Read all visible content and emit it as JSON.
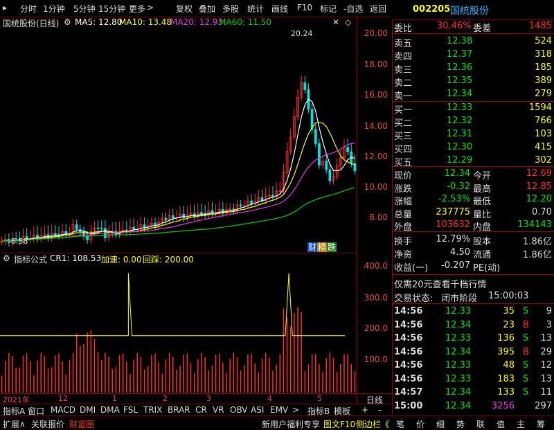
{
  "toolbar": {
    "items": [
      "分时",
      "1分钟",
      "5分钟",
      "15分钟",
      "更多",
      "复权",
      "叠加",
      "多股",
      "统计",
      "画线",
      "F10",
      "标记",
      "-自选",
      "返回"
    ]
  },
  "stock": {
    "code": "002205",
    "name": "国统股份"
  },
  "chart_header": {
    "title": "国统股份(日线)",
    "ma5": "MA5: 12.80",
    "ma10": "MA10: 13.48",
    "ma20": "MA20: 12.93",
    "ma60": "MA60: 11.50",
    "high_label": "20.24",
    "low_label": "6.58",
    "badges": [
      "财",
      "精",
      "跌"
    ]
  },
  "indicator_header": {
    "label": "指标公式",
    "cr1": "CR1: 108.53",
    "speed": "加速: 0.00",
    "pullback": "回踩: 200.00"
  },
  "y_axis": {
    "main_ticks": [
      "20.00",
      "18.00",
      "16.00",
      "14.00",
      "12.00",
      "10.00",
      "8.00"
    ],
    "ind_ticks": [
      "400.0",
      "300.0",
      "200.0",
      "100.0"
    ]
  },
  "date_axis": {
    "labels": [
      "2021年",
      "12",
      "1",
      "2",
      "3",
      "4",
      "5"
    ],
    "right": "日线"
  },
  "indicator_tabs": [
    "指标A",
    "窗口",
    "MACD",
    "DMI",
    "DMA",
    "FSL",
    "TRIX",
    "BRAR",
    "CR",
    "VR",
    "OBV",
    "ASI",
    "EMV",
    "指标B",
    "模板"
  ],
  "bottom_bar": {
    "left": [
      "扩展∧",
      "关联报价",
      "财富圈"
    ],
    "middle": [
      "新用户福利专享",
      "图文F10",
      "侧边栏《"
    ],
    "right_tabs": [
      "笔",
      "价",
      "细",
      "势",
      "联",
      "值",
      "主",
      "筹"
    ]
  },
  "quote": {
    "wei_bi_label": "委比",
    "wei_bi": "30.46%",
    "wei_cha_label": "委差",
    "wei_cha": "1485",
    "asks": [
      {
        "label": "卖五",
        "price": "12.38",
        "vol": "524"
      },
      {
        "label": "卖四",
        "price": "12.37",
        "vol": "318"
      },
      {
        "label": "卖三",
        "price": "12.36",
        "vol": "185"
      },
      {
        "label": "卖二",
        "price": "12.35",
        "vol": "389"
      },
      {
        "label": "卖一",
        "price": "12.34",
        "vol": "279"
      }
    ],
    "bids": [
      {
        "label": "买一",
        "price": "12.33",
        "vol": "1594"
      },
      {
        "label": "买二",
        "price": "12.32",
        "vol": "766"
      },
      {
        "label": "买三",
        "price": "12.31",
        "vol": "103"
      },
      {
        "label": "买四",
        "price": "12.30",
        "vol": "415"
      },
      {
        "label": "买五",
        "price": "12.29",
        "vol": "302"
      }
    ],
    "stats": [
      {
        "l1": "现价",
        "v1": "12.34",
        "l2": "今开",
        "v2": "12.69"
      },
      {
        "l1": "涨跌",
        "v1": "-0.32",
        "l2": "最高",
        "v2": "12.85"
      },
      {
        "l1": "涨幅",
        "v1": "-2.53%",
        "l2": "最低",
        "v2": "12.20"
      },
      {
        "l1": "总量",
        "v1": "237775",
        "l2": "量比",
        "v2": "0.70"
      },
      {
        "l1": "外盘",
        "v1": "103632",
        "l2": "内盘",
        "v2": "134143"
      }
    ],
    "stats2": [
      {
        "l1": "换手",
        "v1": "12.79%",
        "l2": "股本",
        "v2": "1.86亿"
      },
      {
        "l1": "净资",
        "v1": "4.50",
        "l2": "流通",
        "v2": "1.86亿"
      },
      {
        "l1": "收益(一)",
        "v1": "-0.207",
        "l2": "PE(动)",
        "v2": ""
      }
    ],
    "promo": "仅需20元查看千档行情",
    "status_label": "交易状态:",
    "status": "闭市阶段",
    "status_time": "15:00:03",
    "ticks": [
      {
        "t": "14:56",
        "p": "12.33",
        "v": "35",
        "d": "S",
        "n": "9"
      },
      {
        "t": "14:56",
        "p": "12.34",
        "v": "23",
        "d": "B",
        "n": "3"
      },
      {
        "t": "14:56",
        "p": "12.33",
        "v": "136",
        "d": "S",
        "n": "13"
      },
      {
        "t": "14:56",
        "p": "12.34",
        "v": "395",
        "d": "B",
        "n": "29"
      },
      {
        "t": "14:56",
        "p": "12.33",
        "v": "48",
        "d": "S",
        "n": "12"
      },
      {
        "t": "14:56",
        "p": "12.33",
        "v": "183",
        "d": "S",
        "n": "13"
      },
      {
        "t": "14:57",
        "p": "12.34",
        "v": "133",
        "d": "S",
        "n": "11"
      },
      {
        "t": "15:00",
        "p": "12.34",
        "v": "3256",
        "d": "",
        "n": "297"
      }
    ]
  },
  "colors": {
    "up": "#ff3030",
    "down": "#00e000",
    "ma5": "#ffffff",
    "ma10": "#ffff00",
    "ma20": "#e040e0",
    "ma60": "#00d000"
  }
}
